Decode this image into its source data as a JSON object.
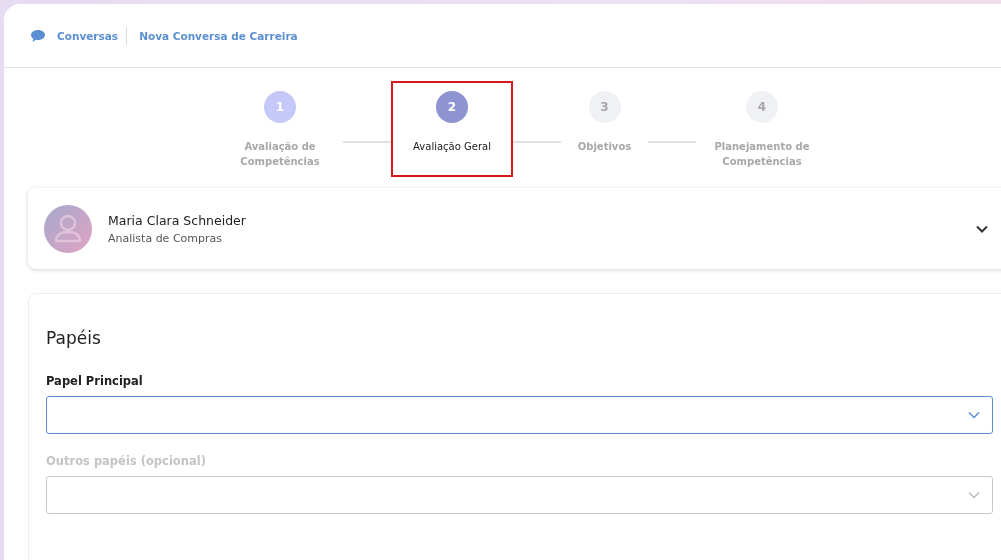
{
  "breadcrumb": [
    {
      "label": "Conversas"
    },
    {
      "label": "Nova Conversa de Carreira"
    }
  ],
  "steps": [
    {
      "number": "1",
      "label": "Avaliação de Competências",
      "kind": "done",
      "highlighted": false
    },
    {
      "number": "2",
      "label": "Avaliação Geral",
      "kind": "current",
      "highlighted": true
    },
    {
      "number": "3",
      "label": "Objetivos",
      "kind": "upcoming",
      "highlighted": false
    },
    {
      "number": "4",
      "label": "Planejamento de Competências",
      "kind": "upcoming",
      "highlighted": false
    }
  ],
  "person": {
    "name": "Maria Clara Schneider",
    "role": "Analista de Compras",
    "expanded": false
  },
  "section": {
    "title": "Papéis",
    "fields": [
      {
        "label": "Papel Principal",
        "focused": true,
        "disabled": false
      },
      {
        "label": "Outros papéis (opcional)",
        "focused": false,
        "disabled": true
      }
    ]
  }
}
